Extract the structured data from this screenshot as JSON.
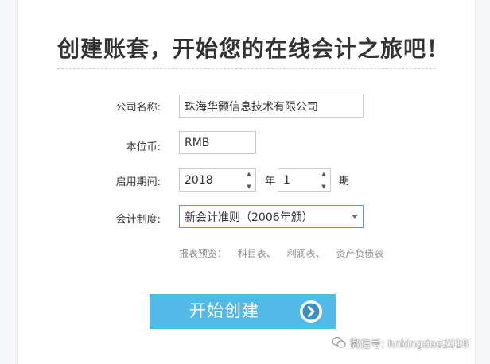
{
  "title": "创建账套，开始您的在线会计之旅吧！",
  "form": {
    "company": {
      "label": "公司名称:",
      "value": "珠海华颢信息技术有限公司"
    },
    "currency": {
      "label": "本位币:",
      "value": "RMB"
    },
    "period": {
      "label": "启用期间:",
      "year_value": "2018",
      "year_unit": "年",
      "month_value": "1",
      "month_unit": "期"
    },
    "system": {
      "label": "会计制度:",
      "value": "新会计准则（2006年颁）"
    }
  },
  "preview": {
    "label": "报表预览：",
    "links": [
      "科目表、",
      "利润表、",
      "资产负债表"
    ]
  },
  "start_button": {
    "label": "开始创建"
  },
  "watermark": {
    "text": "微信号: hnkingdee2018"
  },
  "colors": {
    "button": "#52b9e9",
    "select_border": "#5b9bd5",
    "preview_text": "#888888"
  }
}
